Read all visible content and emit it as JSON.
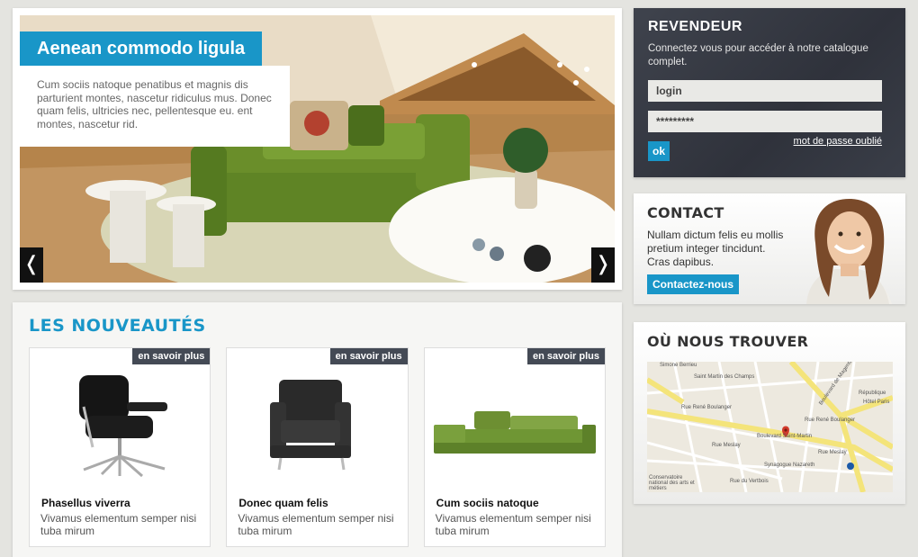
{
  "hero": {
    "title": "Aenean commodo ligula",
    "caption": "Cum sociis natoque penatibus et magnis dis parturient montes, nascetur ridiculus mus. Donec quam felis, ultricies nec, pellentesque eu. ent montes, nascetur rid.",
    "prev_label": "❬",
    "next_label": "❭"
  },
  "revendeur": {
    "title": "REVENDEUR",
    "text": "Connectez vous pour accéder à notre catalogue complet.",
    "login_value": "login",
    "password_value": "*********",
    "ok_label": "ok",
    "forgot_label": "mot de passe oublié"
  },
  "contact": {
    "title": "CONTACT",
    "text": "Nullam dictum felis eu mollis pretium integer tincidunt. Cras dapibus.",
    "button_label": "Contactez-nous"
  },
  "map": {
    "title": "OÙ NOUS TROUVER",
    "labels": [
      "Simone Berrieu",
      "Saint Martin des Champs",
      "Rue René Boulanger",
      "Rue René Boulanger",
      "Boulevard Saint-Martin",
      "Rue Meslay",
      "Rue Meslay",
      "Synagogue Nazareth",
      "Rue du Vertbois",
      "Conservatoire national des arts et métiers",
      "Boulevard de Magenta",
      "République",
      "Hôtel Paris"
    ]
  },
  "news": {
    "title": "LES NOUVEAUTÉS",
    "items": [
      {
        "tag": "en savoir plus",
        "title": "Phasellus viverra",
        "desc": "Vivamus elementum semper nisi tuba mirum"
      },
      {
        "tag": "en savoir plus",
        "title": "Donec quam felis",
        "desc": "Vivamus elementum semper nisi tuba mirum"
      },
      {
        "tag": "en savoir plus",
        "title": "Cum sociis natoque",
        "desc": "Vivamus elementum semper nisi tuba mirum"
      }
    ]
  },
  "colors": {
    "accent": "#1996c8",
    "dark_panel": "#353842",
    "tag_bg": "#444a55"
  }
}
